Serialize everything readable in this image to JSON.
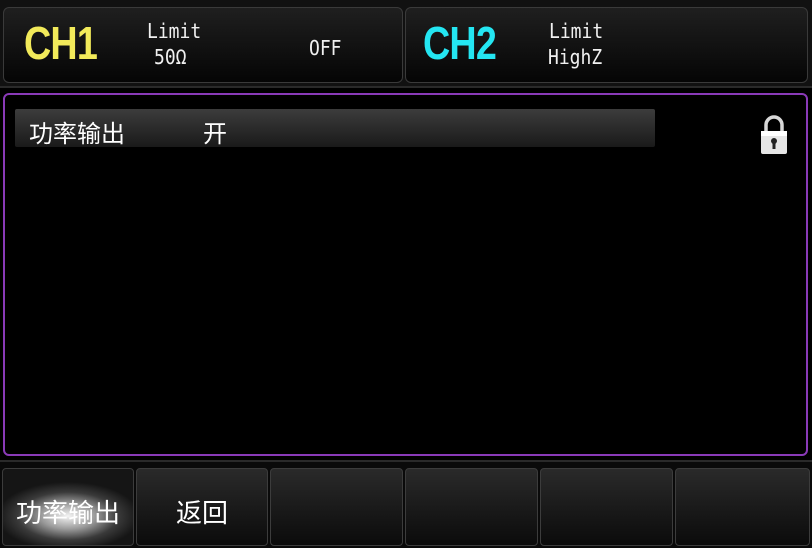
{
  "header": {
    "ch1": {
      "name": "CH1",
      "line1": "Limit",
      "line2": "50Ω",
      "state": "OFF",
      "color": "#f2ea5a"
    },
    "ch2": {
      "name": "CH2",
      "line1": "Limit",
      "line2": "HighZ",
      "color": "#24e6f2"
    }
  },
  "main": {
    "param": {
      "label": "功率输出",
      "value": "开"
    },
    "lock_icon": "lock-icon",
    "border_color": "#8a3ab8"
  },
  "softkeys": [
    {
      "label": "功率输出",
      "active": true
    },
    {
      "label": "返回",
      "active": false
    },
    {
      "label": "",
      "active": false
    },
    {
      "label": "",
      "active": false
    },
    {
      "label": "",
      "active": false
    },
    {
      "label": "",
      "active": false
    }
  ]
}
